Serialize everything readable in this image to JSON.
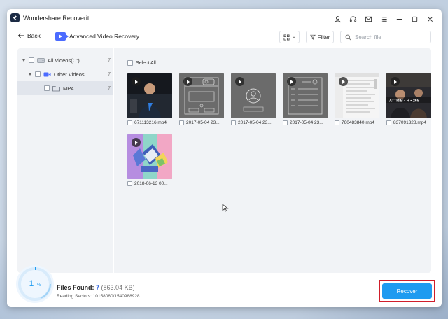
{
  "window": {
    "title": "Wondershare Recoverit"
  },
  "toolbar": {
    "back_label": "Back",
    "mode_label": "Advanced Video Recovery",
    "filter_label": "Filter",
    "search_placeholder": "Search file"
  },
  "sidebar": {
    "items": [
      {
        "label": "All Videos(C:)",
        "count": "7",
        "icon": "drive-icon"
      },
      {
        "label": "Other Videos",
        "count": "7",
        "icon": "video-folder-icon"
      },
      {
        "label": "MP4",
        "count": "7",
        "icon": "folder-icon"
      }
    ]
  },
  "content": {
    "select_all_label": "Select All",
    "files": [
      {
        "name": "671113216.mp4",
        "thumb": "person-dark"
      },
      {
        "name": "2017-05-04 23...",
        "thumb": "gray-ui"
      },
      {
        "name": "2017-05-04 23...",
        "thumb": "gray-avatar"
      },
      {
        "name": "2017-05-04 23...",
        "thumb": "gray-list"
      },
      {
        "name": "760483840.mp4",
        "thumb": "document"
      },
      {
        "name": "837091328.mp4",
        "thumb": "person-dark-text"
      },
      {
        "name": "2018-06-13 00...",
        "thumb": "colorful"
      }
    ]
  },
  "status": {
    "progress_percent": "1",
    "progress_suffix": "%",
    "files_found_label": "Files Found:",
    "files_found_count": "7",
    "files_found_size": "(863.04 KB)",
    "reading_sectors": "Reading Sectors: 10158080/1540988928",
    "pause_icon": "pause-icon",
    "stop_icon": "stop-icon",
    "recover_label": "Recover"
  },
  "colors": {
    "accent": "#1e9bf0",
    "highlight": "#d01e2a"
  }
}
